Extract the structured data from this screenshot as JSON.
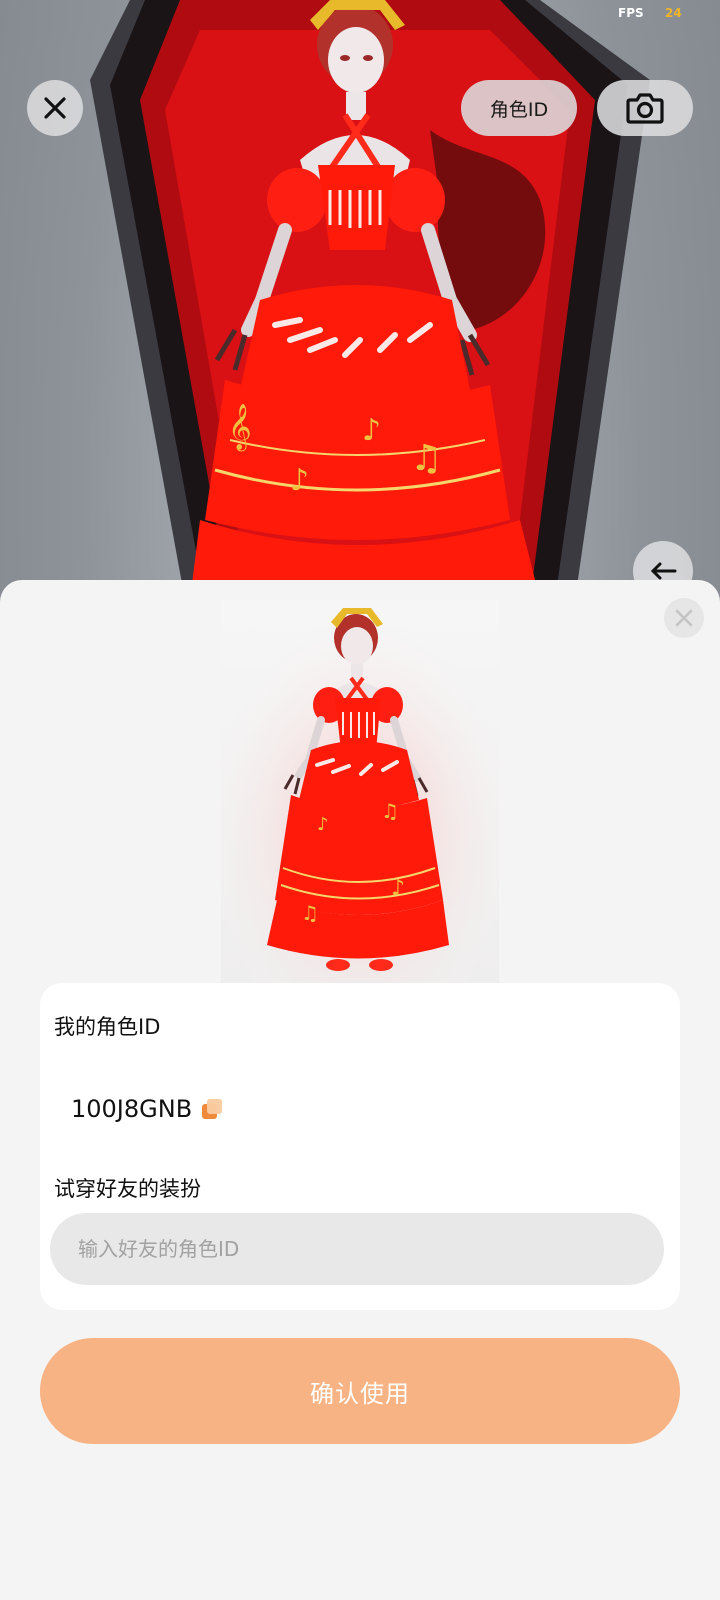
{
  "status": {
    "fps_label": "FPS",
    "fps_value": "24"
  },
  "header": {
    "role_id_button": "角色ID",
    "close_icon": "close-icon",
    "camera_icon": "camera-icon",
    "back_icon": "back-arrow-icon"
  },
  "sheet": {
    "close_icon": "close-icon",
    "my_id_label": "我的角色ID",
    "my_id_value": "100J8GNB",
    "copy_icon": "copy-icon",
    "tryon_label": "试穿好友的装扮",
    "friend_input": {
      "value": "",
      "placeholder": "输入好友的角色ID"
    },
    "confirm_button": "确认使用"
  },
  "colors": {
    "accent": "#f7b383",
    "dress_red": "#ff1a0a",
    "gold": "#f0c040",
    "fps_value": "#f0b429"
  }
}
